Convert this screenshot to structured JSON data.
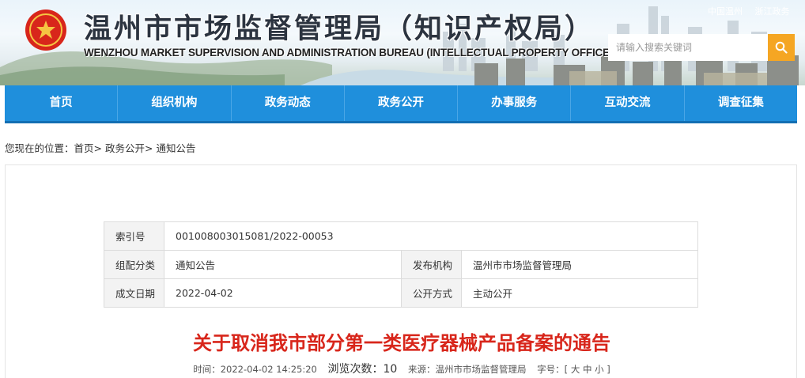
{
  "header": {
    "title": "温州市市场监督管理局（知识产权局）",
    "subtitle": "WENZHOU MARKET SUPERVISION AND ADMINISTRATION BUREAU (INTELLECTUAL PROPERTY OFFICE)",
    "top_links": [
      "中国温州",
      "浙江政务"
    ],
    "search_placeholder": "请输入搜索关键词",
    "search_icon": "search-icon"
  },
  "nav": {
    "items": [
      "首页",
      "组织机构",
      "政务动态",
      "政务公开",
      "办事服务",
      "互动交流",
      "调查征集"
    ]
  },
  "breadcrumb": {
    "prefix": "您现在的位置：",
    "items": [
      "首页",
      "政务公开",
      "通知公告"
    ],
    "separator": ">"
  },
  "meta": {
    "index_label": "索引号",
    "index_value": "001008003015081/2022-00053",
    "category_label": "组配分类",
    "category_value": "通知公告",
    "publisher_label": "发布机构",
    "publisher_value": "温州市市场监督管理局",
    "date_label": "成文日期",
    "date_value": "2022-04-02",
    "mode_label": "公开方式",
    "mode_value": "主动公开"
  },
  "article": {
    "title": "关于取消我市部分第一类医疗器械产品备案的通告",
    "time_label": "时间：",
    "time_value": "2022-04-02 14:25:20",
    "views_label": "浏览次数：",
    "views_value": "10",
    "source_label": "来源：",
    "source_value": "温州市市场监督管理局",
    "fontsize_label": "字号：",
    "fontsize_open": "[",
    "fontsize_large": "大",
    "fontsize_medium": "中",
    "fontsize_small": "小",
    "fontsize_close": "]"
  },
  "colors": {
    "nav_bg": "#1f8fdc",
    "search_button": "#f5a623",
    "title_red": "#d8261b"
  }
}
